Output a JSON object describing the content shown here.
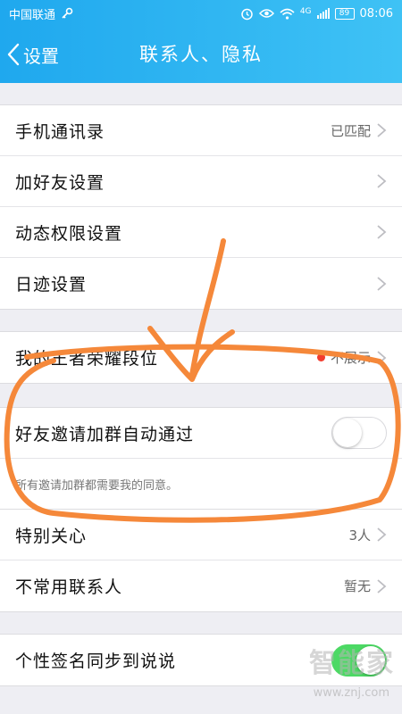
{
  "status_bar": {
    "carrier": "中国联通",
    "network_type": "4G",
    "battery": "89",
    "time": "08:06"
  },
  "nav": {
    "back_label": "设置",
    "title": "联系人、隐私"
  },
  "group1": [
    {
      "label": "手机通讯录",
      "value": "已匹配"
    },
    {
      "label": "加好友设置",
      "value": ""
    },
    {
      "label": "动态权限设置",
      "value": ""
    },
    {
      "label": "日迹设置",
      "value": ""
    }
  ],
  "honor_row": {
    "label": "我的王者荣耀段位",
    "value": "不展示"
  },
  "group_invite": {
    "label": "好友邀请加群自动通过",
    "toggle_on": false,
    "hint": "所有邀请加群都需要我的同意。"
  },
  "group3": [
    {
      "label": "特别关心",
      "value": "3人"
    },
    {
      "label": "不常用联系人",
      "value": "暂无"
    }
  ],
  "signature_row": {
    "label": "个性签名同步到说说",
    "toggle_on": true
  },
  "watermark": {
    "brand": "智能家",
    "url": "www.znj.com"
  },
  "colors": {
    "header_start": "#1fa8ee",
    "header_end": "#3fc2f5",
    "toggle_on": "#4cd964",
    "annotation": "#f5883a",
    "dot_red": "#f23c2e"
  },
  "icons": [
    "key-icon",
    "alarm-icon",
    "eye-icon",
    "wifi-icon",
    "signal-icon",
    "battery-icon",
    "back-chevron-icon",
    "chevron-right-icon"
  ]
}
